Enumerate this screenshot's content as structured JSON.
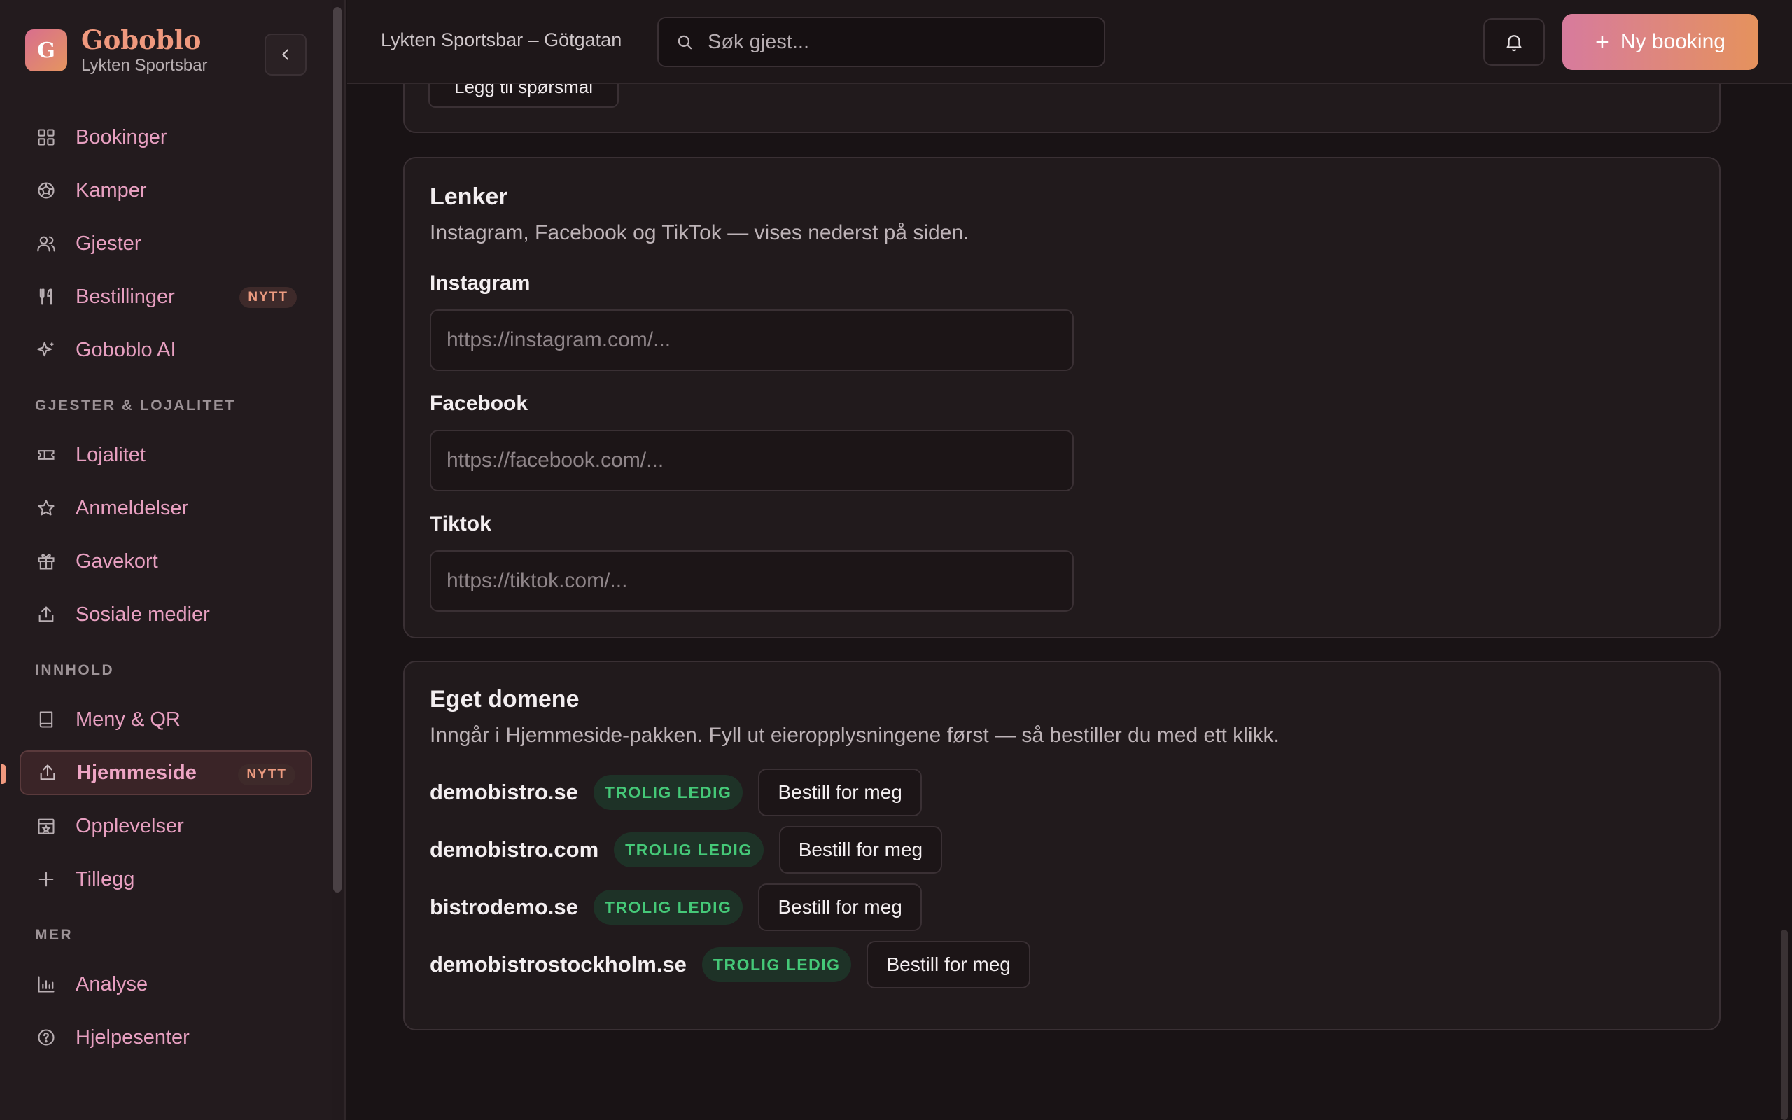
{
  "sidebar": {
    "brand_initial": "G",
    "brand_name": "Goboblo",
    "brand_sub": "Lykten Sportsbar",
    "items_main": [
      {
        "label": "Bookinger",
        "icon": "grid-icon"
      },
      {
        "label": "Kamper",
        "icon": "football-icon"
      },
      {
        "label": "Gjester",
        "icon": "users-icon"
      },
      {
        "label": "Bestillinger",
        "icon": "utensils-icon",
        "badge": "NYTT"
      },
      {
        "label": "Goboblo AI",
        "icon": "sparkles-icon"
      }
    ],
    "section_loyalty": "GJESTER & LOJALITET",
    "items_loyalty": [
      {
        "label": "Lojalitet",
        "icon": "ticket-icon"
      },
      {
        "label": "Anmeldelser",
        "icon": "star-icon"
      },
      {
        "label": "Gavekort",
        "icon": "gift-icon"
      },
      {
        "label": "Sosiale medier",
        "icon": "share-icon"
      }
    ],
    "section_content": "INNHOLD",
    "items_content": [
      {
        "label": "Meny & QR",
        "icon": "book-icon"
      },
      {
        "label": "Hjemmeside",
        "icon": "upload-icon",
        "badge": "NYTT",
        "active": true
      },
      {
        "label": "Opplevelser",
        "icon": "calendar-icon"
      },
      {
        "label": "Tillegg",
        "icon": "plus-icon"
      }
    ],
    "section_more": "MER",
    "items_more": [
      {
        "label": "Analyse",
        "icon": "bar-chart-icon"
      },
      {
        "label": "Hjelpesenter",
        "icon": "help-circle-icon"
      }
    ]
  },
  "header": {
    "venue": "Lykten Sportsbar – Götgatan",
    "search_placeholder": "Søk gjest...",
    "new_booking_label": "Ny booking"
  },
  "prev_card": {
    "button_label": "Legg til spørsmål"
  },
  "links_card": {
    "title": "Lenker",
    "description": "Instagram, Facebook og TikTok — vises nederst på siden.",
    "fields": [
      {
        "label": "Instagram",
        "placeholder": "https://instagram.com/...",
        "value": ""
      },
      {
        "label": "Facebook",
        "placeholder": "https://facebook.com/...",
        "value": ""
      },
      {
        "label": "Tiktok",
        "placeholder": "https://tiktok.com/...",
        "value": ""
      }
    ]
  },
  "domain_card": {
    "title": "Eget domene",
    "description": "Inngår i Hjemmeside‑pakken. Fyll ut eieropplysningene først — så bestiller du med ett klikk.",
    "domains": [
      {
        "name": "demobistro.se",
        "status": "TROLIG LEDIG",
        "action": "Bestill for meg"
      },
      {
        "name": "demobistro.com",
        "status": "TROLIG LEDIG",
        "action": "Bestill for meg"
      },
      {
        "name": "bistrodemo.se",
        "status": "TROLIG LEDIG",
        "action": "Bestill for meg"
      },
      {
        "name": "demobistrostockholm.se",
        "status": "TROLIG LEDIG",
        "action": "Bestill for meg"
      }
    ]
  },
  "colors": {
    "accent": "#f0997e",
    "nav_text": "#e79fc0",
    "available_green": "#45c978",
    "background": "#191315"
  }
}
